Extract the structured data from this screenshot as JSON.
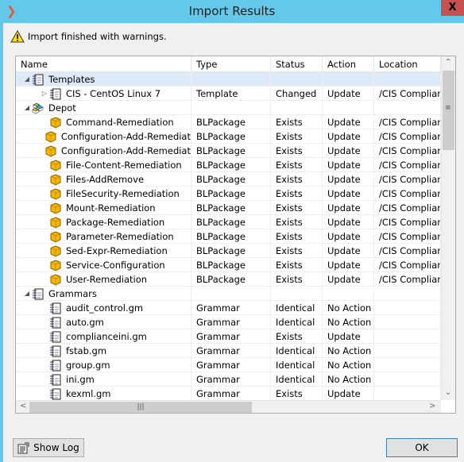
{
  "window": {
    "title": "Import Results",
    "close": "X"
  },
  "message": "Import finished with warnings.",
  "columns": [
    "Name",
    "Type",
    "Status",
    "Action",
    "Location"
  ],
  "rows": [
    {
      "level": 0,
      "expander": "open",
      "icon": "template-icon",
      "name": "Templates",
      "type": "",
      "status": "",
      "action": "",
      "location": "",
      "selected": true
    },
    {
      "level": 1,
      "expander": "closed",
      "icon": "template-icon",
      "name": "CIS - CentOS Linux 7",
      "type": "Template",
      "status": "Changed",
      "action": "Update",
      "location": "/CIS Complian"
    },
    {
      "level": 0,
      "expander": "open",
      "icon": "depot-icon",
      "name": "Depot",
      "type": "",
      "status": "",
      "action": "",
      "location": ""
    },
    {
      "level": 1,
      "icon": "package-icon",
      "name": "Command-Remediation",
      "type": "BLPackage",
      "status": "Exists",
      "action": "Update",
      "location": "/CIS Complian"
    },
    {
      "level": 1,
      "icon": "package-icon",
      "name": "Configuration-Add-Remediat",
      "type": "BLPackage",
      "status": "Exists",
      "action": "Update",
      "location": "/CIS Complian"
    },
    {
      "level": 1,
      "icon": "package-icon",
      "name": "Configuration-Add-Remediat",
      "type": "BLPackage",
      "status": "Exists",
      "action": "Update",
      "location": "/CIS Complian"
    },
    {
      "level": 1,
      "icon": "package-icon",
      "name": "File-Content-Remediation",
      "type": "BLPackage",
      "status": "Exists",
      "action": "Update",
      "location": "/CIS Complian"
    },
    {
      "level": 1,
      "icon": "package-icon",
      "name": "Files-AddRemove",
      "type": "BLPackage",
      "status": "Exists",
      "action": "Update",
      "location": "/CIS Complian"
    },
    {
      "level": 1,
      "icon": "package-icon",
      "name": "FileSecurity-Remediation",
      "type": "BLPackage",
      "status": "Exists",
      "action": "Update",
      "location": "/CIS Complian"
    },
    {
      "level": 1,
      "icon": "package-icon",
      "name": "Mount-Remediation",
      "type": "BLPackage",
      "status": "Exists",
      "action": "Update",
      "location": "/CIS Complian"
    },
    {
      "level": 1,
      "icon": "package-icon",
      "name": "Package-Remediation",
      "type": "BLPackage",
      "status": "Exists",
      "action": "Update",
      "location": "/CIS Complian"
    },
    {
      "level": 1,
      "icon": "package-icon",
      "name": "Parameter-Remediation",
      "type": "BLPackage",
      "status": "Exists",
      "action": "Update",
      "location": "/CIS Complian"
    },
    {
      "level": 1,
      "icon": "package-icon",
      "name": "Sed-Expr-Remediation",
      "type": "BLPackage",
      "status": "Exists",
      "action": "Update",
      "location": "/CIS Complian"
    },
    {
      "level": 1,
      "icon": "package-icon",
      "name": "Service-Configuration",
      "type": "BLPackage",
      "status": "Exists",
      "action": "Update",
      "location": "/CIS Complian"
    },
    {
      "level": 1,
      "icon": "package-icon",
      "name": "User-Remediation",
      "type": "BLPackage",
      "status": "Exists",
      "action": "Update",
      "location": "/CIS Complian"
    },
    {
      "level": 0,
      "expander": "open",
      "icon": "grammar-icon",
      "name": "Grammars",
      "type": "",
      "status": "",
      "action": "",
      "location": ""
    },
    {
      "level": 1,
      "icon": "grammar-icon",
      "name": "audit_control.gm",
      "type": "Grammar",
      "status": "Identical",
      "action": "No Action",
      "location": ""
    },
    {
      "level": 1,
      "icon": "grammar-icon",
      "name": "auto.gm",
      "type": "Grammar",
      "status": "Identical",
      "action": "No Action",
      "location": ""
    },
    {
      "level": 1,
      "icon": "grammar-icon",
      "name": "complianceini.gm",
      "type": "Grammar",
      "status": "Exists",
      "action": "Update",
      "location": ""
    },
    {
      "level": 1,
      "icon": "grammar-icon",
      "name": "fstab.gm",
      "type": "Grammar",
      "status": "Identical",
      "action": "No Action",
      "location": ""
    },
    {
      "level": 1,
      "icon": "grammar-icon",
      "name": "group.gm",
      "type": "Grammar",
      "status": "Identical",
      "action": "No Action",
      "location": ""
    },
    {
      "level": 1,
      "icon": "grammar-icon",
      "name": "ini.gm",
      "type": "Grammar",
      "status": "Identical",
      "action": "No Action",
      "location": ""
    },
    {
      "level": 1,
      "icon": "grammar-icon",
      "name": "kexml.gm",
      "type": "Grammar",
      "status": "Exists",
      "action": "Update",
      "location": ""
    }
  ],
  "buttons": {
    "show_log": "Show Log",
    "ok": "OK"
  },
  "colors": {
    "titlebar": "#63c8ea",
    "selected_row": "#dceaf9",
    "close": "#c75050"
  }
}
